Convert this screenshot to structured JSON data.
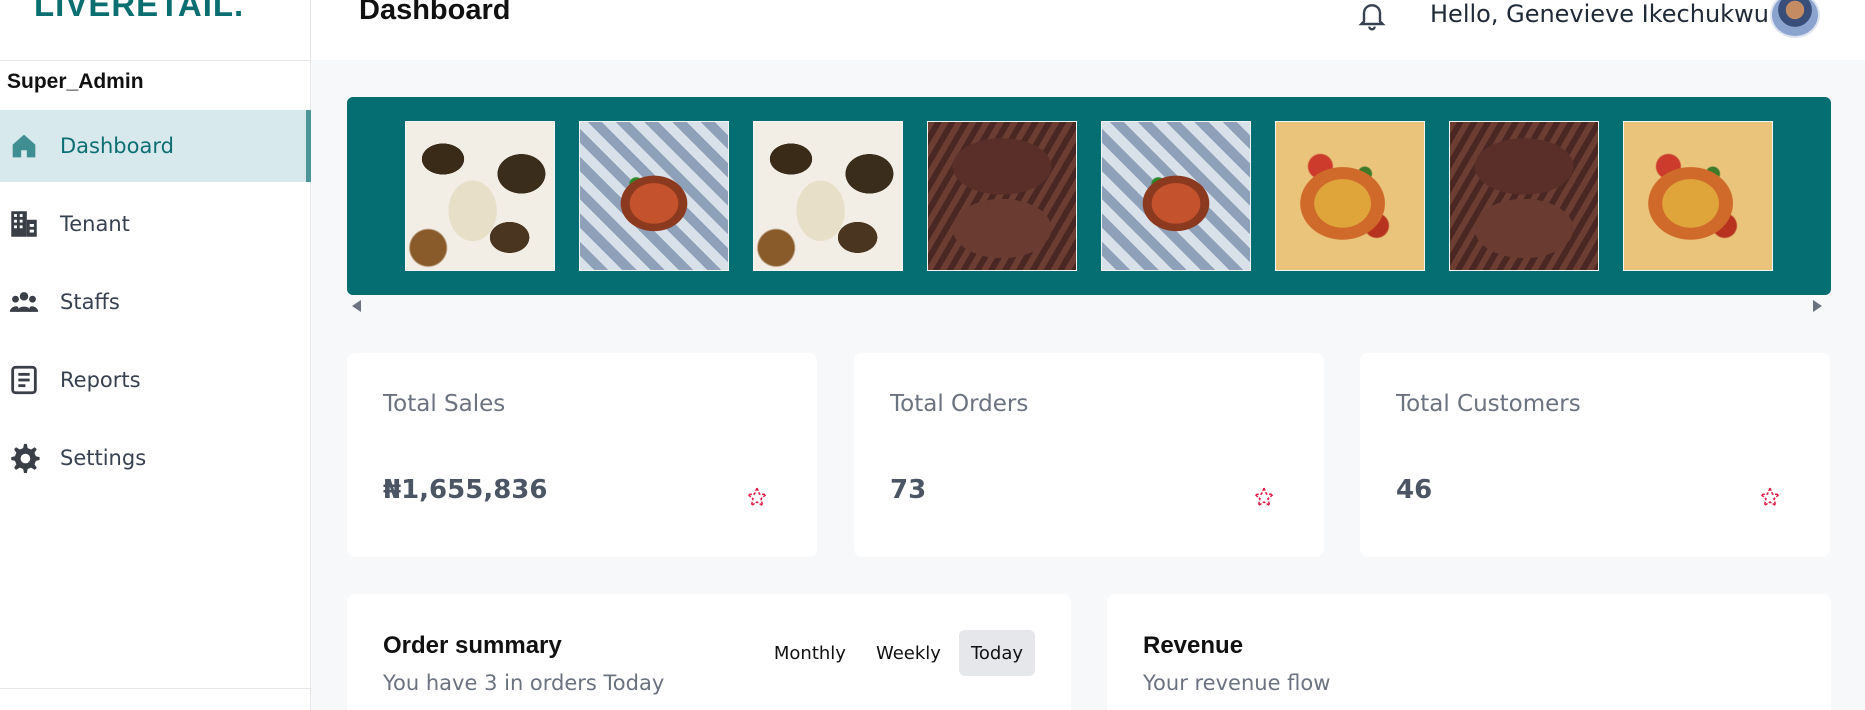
{
  "brand": {
    "logo_text": "LIVERETAIL.",
    "accent": "#0b6e70"
  },
  "sidebar": {
    "role": "Super_Admin",
    "items": [
      {
        "label": "Dashboard",
        "icon": "home-icon",
        "active": true
      },
      {
        "label": "Tenant",
        "icon": "building-icon",
        "active": false
      },
      {
        "label": "Staffs",
        "icon": "users-icon",
        "active": false
      },
      {
        "label": "Reports",
        "icon": "report-icon",
        "active": false
      },
      {
        "label": "Settings",
        "icon": "gear-icon",
        "active": false
      }
    ]
  },
  "header": {
    "title": "Dashboard",
    "greeting": "Hello, Genevieve Ikechukwu",
    "notification_icon": "bell-icon"
  },
  "carousel": {
    "background": "#046e73",
    "images": [
      "food-image",
      "food-image",
      "food-image",
      "food-image",
      "food-image",
      "food-image",
      "food-image",
      "food-image"
    ]
  },
  "stats": [
    {
      "label": "Total Sales",
      "value": "₦1,655,836",
      "icon": "star-icon"
    },
    {
      "label": "Total Orders",
      "value": "73",
      "icon": "star-icon"
    },
    {
      "label": "Total Customers",
      "value": "46",
      "icon": "star-icon"
    }
  ],
  "order_summary": {
    "title": "Order summary",
    "subtitle": "You have 3 in orders Today",
    "tabs": [
      {
        "label": "Monthly",
        "active": false
      },
      {
        "label": "Weekly",
        "active": false
      },
      {
        "label": "Today",
        "active": true
      }
    ]
  },
  "revenue": {
    "title": "Revenue",
    "subtitle": "Your revenue flow"
  }
}
